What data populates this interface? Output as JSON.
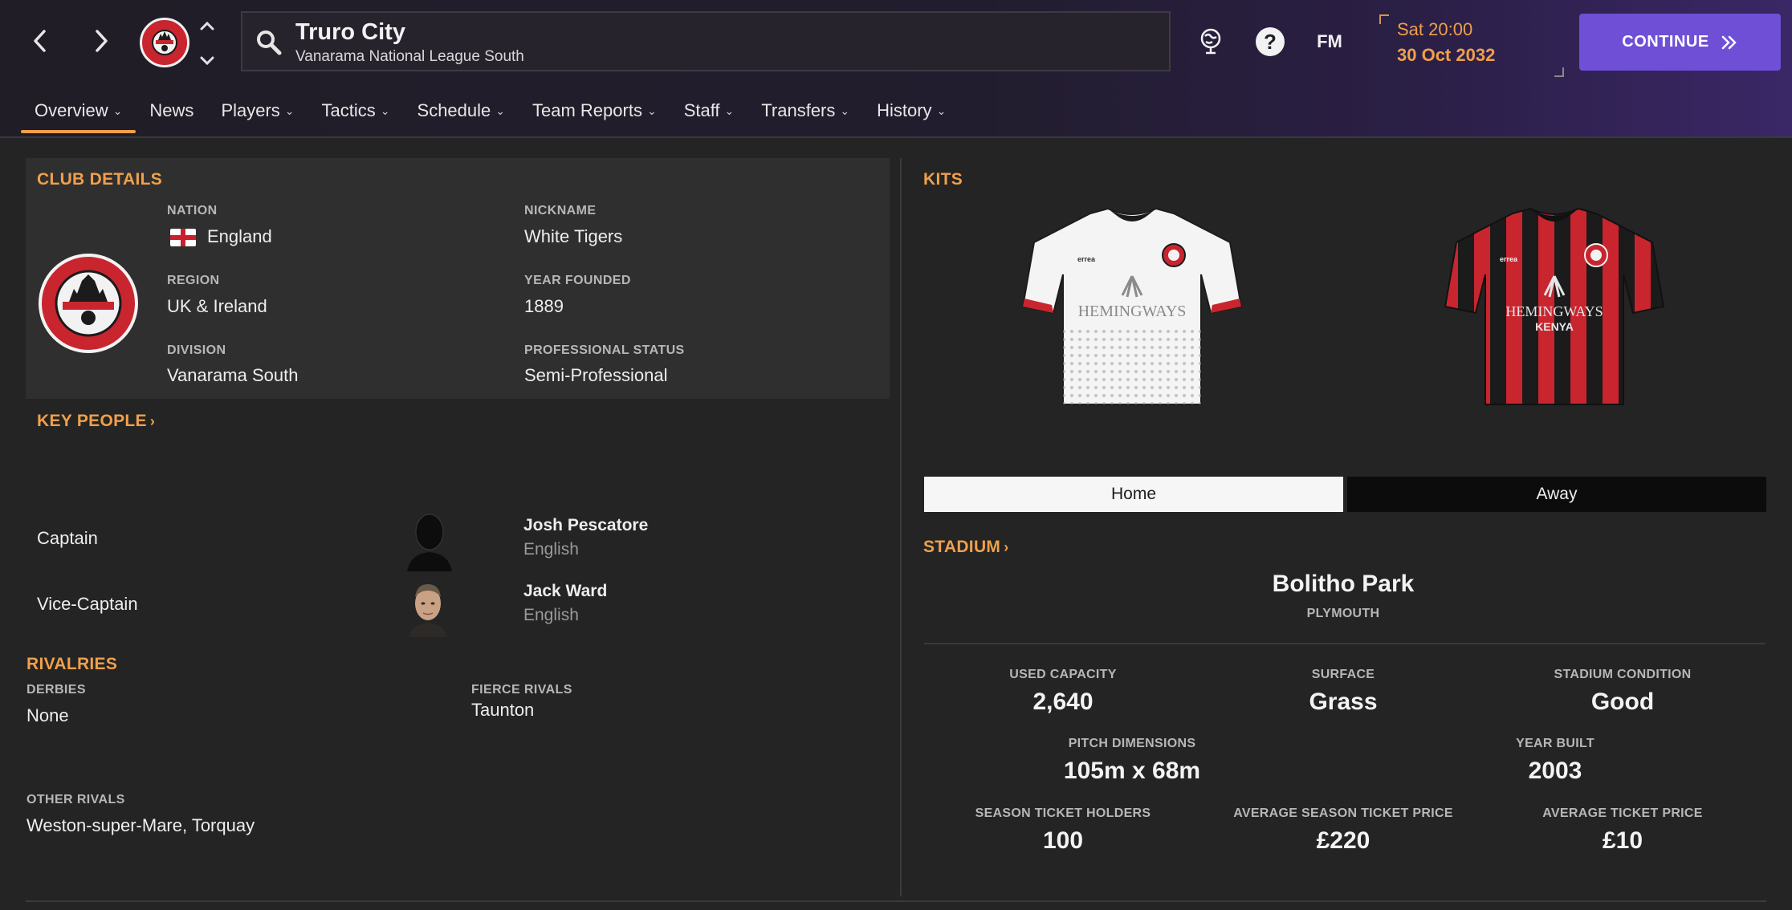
{
  "header": {
    "club_name": "Truro City",
    "league": "Vanarama National League South",
    "fm_label": "FM",
    "date_day_time": "Sat 20:00",
    "date": "30 Oct 2032",
    "continue_label": "CONTINUE"
  },
  "tabs": [
    {
      "label": "Overview",
      "active": true
    },
    {
      "label": "News"
    },
    {
      "label": "Players"
    },
    {
      "label": "Tactics"
    },
    {
      "label": "Schedule"
    },
    {
      "label": "Team Reports"
    },
    {
      "label": "Staff"
    },
    {
      "label": "Transfers"
    },
    {
      "label": "History"
    }
  ],
  "club_details": {
    "title": "CLUB DETAILS",
    "nation_label": "NATION",
    "nation": "England",
    "nickname_label": "NICKNAME",
    "nickname": "White Tigers",
    "region_label": "REGION",
    "region": "UK & Ireland",
    "year_founded_label": "YEAR FOUNDED",
    "year_founded": "1889",
    "division_label": "DIVISION",
    "division": "Vanarama South",
    "status_label": "PROFESSIONAL STATUS",
    "status": "Semi-Professional"
  },
  "key_people": {
    "title": "KEY PEOPLE",
    "people": [
      {
        "role": "Captain",
        "name": "Josh Pescatore",
        "nationality": "English"
      },
      {
        "role": "Vice-Captain",
        "name": "Jack Ward",
        "nationality": "English"
      }
    ]
  },
  "rivalries": {
    "title": "RIVALRIES",
    "derbies_label": "DERBIES",
    "derbies": "None",
    "fierce_label": "FIERCE RIVALS",
    "fierce": "Taunton",
    "other_label": "OTHER RIVALS",
    "other": "Weston-super-Mare, Torquay"
  },
  "kits": {
    "title": "KITS",
    "home_label": "Home",
    "away_label": "Away",
    "sponsor_line1": "HEMINGWAYS",
    "sponsor_line2": "KENYA"
  },
  "stadium": {
    "title": "STADIUM",
    "name": "Bolitho Park",
    "city": "PLYMOUTH",
    "used_capacity_label": "USED CAPACITY",
    "used_capacity": "2,640",
    "surface_label": "SURFACE",
    "surface": "Grass",
    "condition_label": "STADIUM CONDITION",
    "condition": "Good",
    "pitch_label": "PITCH DIMENSIONS",
    "pitch": "105m x 68m",
    "year_built_label": "YEAR BUILT",
    "year_built": "2003",
    "season_holders_label": "SEASON TICKET HOLDERS",
    "season_holders": "100",
    "avg_season_price_label": "AVERAGE SEASON TICKET PRICE",
    "avg_season_price": "£220",
    "avg_ticket_label": "AVERAGE TICKET PRICE",
    "avg_ticket": "£10"
  },
  "colors": {
    "accent": "#f0a04b",
    "continue": "#6f4fd6",
    "club_red": "#c9252f"
  }
}
